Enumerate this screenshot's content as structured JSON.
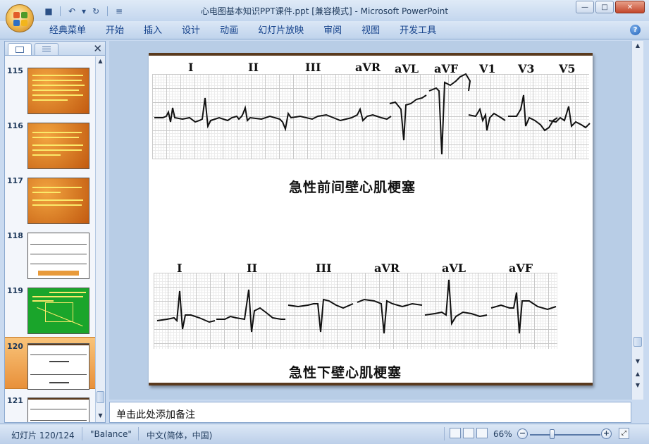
{
  "window": {
    "title": "心电图基本知识PPT课件.ppt [兼容模式] - Microsoft PowerPoint",
    "minimize_glyph": "—",
    "maximize_glyph": "□",
    "close_glyph": "✕"
  },
  "quick_access": [
    {
      "name": "save-icon",
      "glyph": "■"
    },
    {
      "name": "undo-icon",
      "glyph": "↶"
    },
    {
      "name": "undo-dropdown-icon",
      "glyph": "▾"
    },
    {
      "name": "redo-icon",
      "glyph": "↻"
    },
    {
      "name": "customize-qat-icon",
      "glyph": "≡"
    }
  ],
  "ribbon": {
    "tabs": [
      "经典菜单",
      "开始",
      "插入",
      "设计",
      "动画",
      "幻灯片放映",
      "审阅",
      "视图",
      "开发工具"
    ],
    "help_glyph": "?"
  },
  "slide_panel": {
    "close_glyph": "✕",
    "scroll_up": "▲",
    "scroll_down": "▼",
    "slides": [
      {
        "number": "115",
        "style": "orange",
        "selected": false
      },
      {
        "number": "116",
        "style": "orange",
        "selected": false
      },
      {
        "number": "117",
        "style": "orange",
        "selected": false
      },
      {
        "number": "118",
        "style": "white",
        "selected": false
      },
      {
        "number": "119",
        "style": "green",
        "selected": false
      },
      {
        "number": "120",
        "style": "white",
        "selected": true
      },
      {
        "number": "121",
        "style": "white",
        "selected": false
      }
    ]
  },
  "slide": {
    "top_leads": [
      "I",
      "II",
      "III",
      "aVR",
      "aVL",
      "aVF",
      "V1",
      "V3",
      "V5"
    ],
    "top_caption": "急性前间壁心肌梗塞",
    "bottom_leads": [
      "I",
      "II",
      "III",
      "aVR",
      "aVL",
      "aVF"
    ],
    "bottom_caption": "急性下壁心肌梗塞"
  },
  "editor_scroll": {
    "up": "▲",
    "down": "▼",
    "prev_slide": "▲",
    "next_slide": "▼"
  },
  "notes": {
    "placeholder": "单击此处添加备注"
  },
  "status_bar": {
    "slide_counter": "幻灯片 120/124",
    "theme": "\"Balance\"",
    "language": "中文(简体，中国)",
    "zoom_level": "66%",
    "zoom_out": "−",
    "zoom_in": "+",
    "fit_glyph": "⤢"
  }
}
